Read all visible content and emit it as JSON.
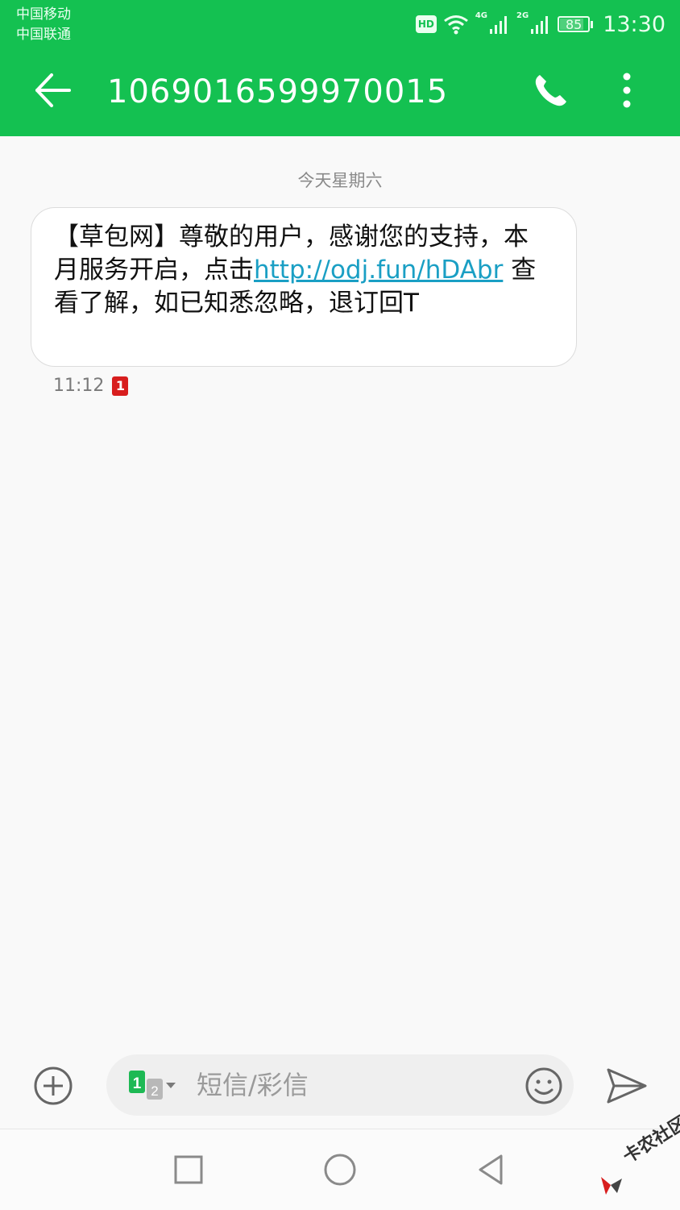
{
  "status_bar": {
    "carrier_1": "中国移动",
    "carrier_2": "中国联通",
    "hd_label": "HD",
    "net_1": "4G",
    "net_2": "2G",
    "battery": "85",
    "time": "13:30"
  },
  "header": {
    "title": "1069016599970015",
    "icons": [
      "back-arrow-icon",
      "phone-icon",
      "more-vertical-icon"
    ]
  },
  "conversation": {
    "date_label": "今天星期六",
    "message": {
      "text_before_link": "【草包网】尊敬的用户，感谢您的支持，本月服务开启，点击",
      "link": "http://odj.fun/hDAbr",
      "text_after_link": " 查看了解，如已知悉忽略，退订回T",
      "time": "11:12",
      "sim_badge": "1"
    }
  },
  "composer": {
    "sim_primary": "1",
    "sim_secondary": "2",
    "placeholder": "短信/彩信",
    "icons": [
      "add-circle-icon",
      "emoji-icon",
      "send-icon"
    ]
  },
  "nav": {
    "icons": [
      "recent-apps-icon",
      "home-icon",
      "back-icon"
    ]
  },
  "watermark": {
    "text": "卡农社区"
  },
  "colors": {
    "header_green": "#14c151",
    "link_blue": "#1a9fc4",
    "sim_badge_red": "#d81e1e"
  }
}
